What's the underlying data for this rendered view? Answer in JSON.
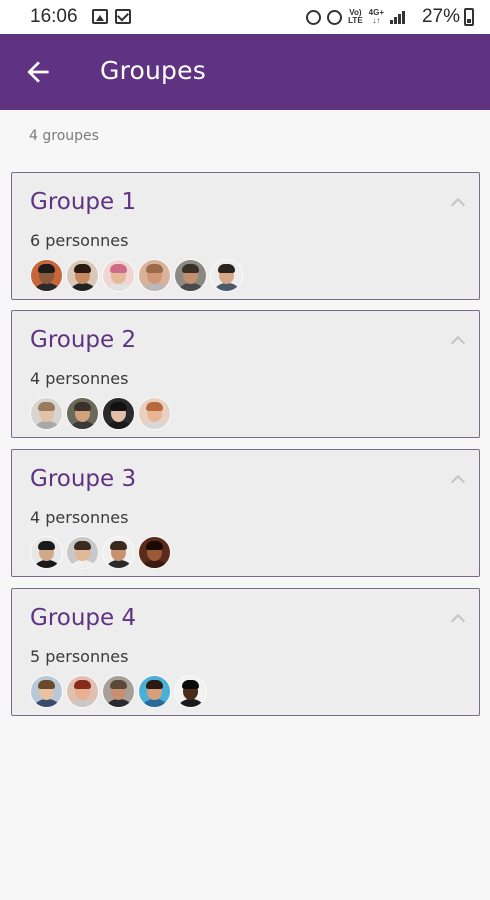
{
  "status_bar": {
    "time": "16:06",
    "battery_percent": "27%",
    "left_icons": [
      "image-icon",
      "message-icon"
    ],
    "right_icons": [
      "alarm-icon",
      "mute-icon",
      "volte-icon",
      "4g-icon",
      "signal-icon",
      "battery-icon"
    ]
  },
  "app_bar": {
    "title": "Groupes",
    "back_icon": "arrow-back-icon",
    "background": "#5f3382"
  },
  "summary": {
    "count_text": "4 groupes"
  },
  "groups": [
    {
      "name": "Groupe 1",
      "members_text": "6 personnes",
      "avatars": [
        {
          "bg": "#c8663a",
          "skin": "#8a5a3a",
          "hair": "#1e1a18",
          "shirt": "#2a2a2a"
        },
        {
          "bg": "#d9c8b8",
          "skin": "#c68a62",
          "hair": "#2a1a12",
          "shirt": "#222222"
        },
        {
          "bg": "#f0d6d0",
          "skin": "#e8b89a",
          "hair": "#d06a8a",
          "shirt": "#e2e2e2"
        },
        {
          "bg": "#d8b39a",
          "skin": "#d09878",
          "hair": "#9a6a4a",
          "shirt": "#b9b9b9"
        },
        {
          "bg": "#8a8a82",
          "skin": "#c09070",
          "hair": "#3a3028",
          "shirt": "#4a4a48"
        },
        {
          "bg": "#ededed",
          "skin": "#d8a888",
          "hair": "#2a2420",
          "shirt": "#4a5a6a"
        }
      ]
    },
    {
      "name": "Groupe 2",
      "members_text": "4 personnes",
      "avatars": [
        {
          "bg": "#d8d4d0",
          "skin": "#e2c2a8",
          "hair": "#9a7a5a",
          "shirt": "#a8a8a8"
        },
        {
          "bg": "#6a6a5a",
          "skin": "#d2a27c",
          "hair": "#3a302a",
          "shirt": "#3a3a38"
        },
        {
          "bg": "#2a2a2a",
          "skin": "#e0c0a8",
          "hair": "#121212",
          "shirt": "#1a1a1a"
        },
        {
          "bg": "#e8d0c2",
          "skin": "#e8b696",
          "hair": "#b86a3a",
          "shirt": "#d8d8d8"
        }
      ]
    },
    {
      "name": "Groupe 3",
      "members_text": "4 personnes",
      "avatars": [
        {
          "bg": "#e8e8e8",
          "skin": "#d2aa8a",
          "hair": "#1a1a1a",
          "shirt": "#1a1a1a"
        },
        {
          "bg": "#c8c8c8",
          "skin": "#e0b896",
          "hair": "#3a2a20",
          "shirt": "#efefef"
        },
        {
          "bg": "#f0f0f0",
          "skin": "#c89270",
          "hair": "#3a2a20",
          "shirt": "#2a2a2a"
        },
        {
          "bg": "#5a2a1a",
          "skin": "#9a5a3a",
          "hair": "#1a0a06",
          "shirt": "#3a1a12"
        }
      ]
    },
    {
      "name": "Groupe 4",
      "members_text": "5 personnes",
      "avatars": [
        {
          "bg": "#b8c8d8",
          "skin": "#e8c2a2",
          "hair": "#6a4a2a",
          "shirt": "#3a4a6a"
        },
        {
          "bg": "#e0c0b0",
          "skin": "#e8b090",
          "hair": "#8a2a1a",
          "shirt": "#c8c8c8"
        },
        {
          "bg": "#a8a098",
          "skin": "#c89070",
          "hair": "#5a4a3a",
          "shirt": "#2a2a2a"
        },
        {
          "bg": "#4ab0d8",
          "skin": "#d8a07a",
          "hair": "#2a1a12",
          "shirt": "#2a6a9a"
        },
        {
          "bg": "#f2f2f2",
          "skin": "#4a2a1a",
          "hair": "#0a0a0a",
          "shirt": "#1a1a1a"
        }
      ]
    }
  ],
  "colors": {
    "accent": "#5f3382",
    "card_bg": "#ededed",
    "card_border": "#7a6b8a",
    "page_bg": "#f7f7f7"
  }
}
